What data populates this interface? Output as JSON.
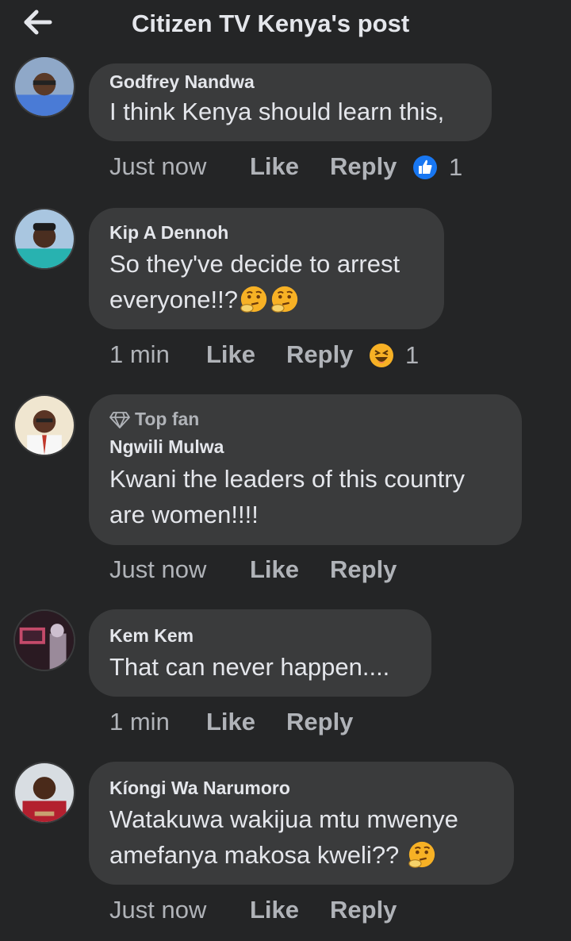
{
  "header": {
    "title": "Citizen TV Kenya's post",
    "back_icon": "arrow-left-icon"
  },
  "colors": {
    "background": "#242526",
    "bubble": "#3a3b3c",
    "text": "#e4e6eb",
    "secondary": "#b0b3b8",
    "like_blue": "#1877f2",
    "haha_yellow": "#f7b125"
  },
  "comments": [
    {
      "name": "Godfrey Nandwa",
      "lines": [
        "I think Kenya should learn this,"
      ],
      "time": "Just now",
      "like": "Like",
      "reply": "Reply",
      "reaction": {
        "icon": "like-reaction-icon",
        "count": "1"
      }
    },
    {
      "name": "Kip A Dennoh",
      "lines": [
        "So they've decide to arrest",
        "everyone!!?"
      ],
      "time": "1 min",
      "like": "Like",
      "reply": "Reply",
      "reaction": {
        "icon": "haha-reaction-icon",
        "count": "1"
      }
    },
    {
      "badge": "Top fan",
      "name": "Ngwili Mulwa",
      "lines": [
        "Kwani the leaders of this country",
        "are women!!!!"
      ],
      "time": "Just now",
      "like": "Like",
      "reply": "Reply"
    },
    {
      "name": "Kem Kem",
      "lines": [
        "That can never happen...."
      ],
      "time": "1 min",
      "like": "Like",
      "reply": "Reply"
    },
    {
      "name": "Kíongi Wa Narumoro",
      "lines": [
        "Watakuwa wakijua mtu mwenye",
        "amefanya makosa kweli??"
      ],
      "time": "Just now",
      "like": "Like",
      "reply": "Reply"
    }
  ]
}
